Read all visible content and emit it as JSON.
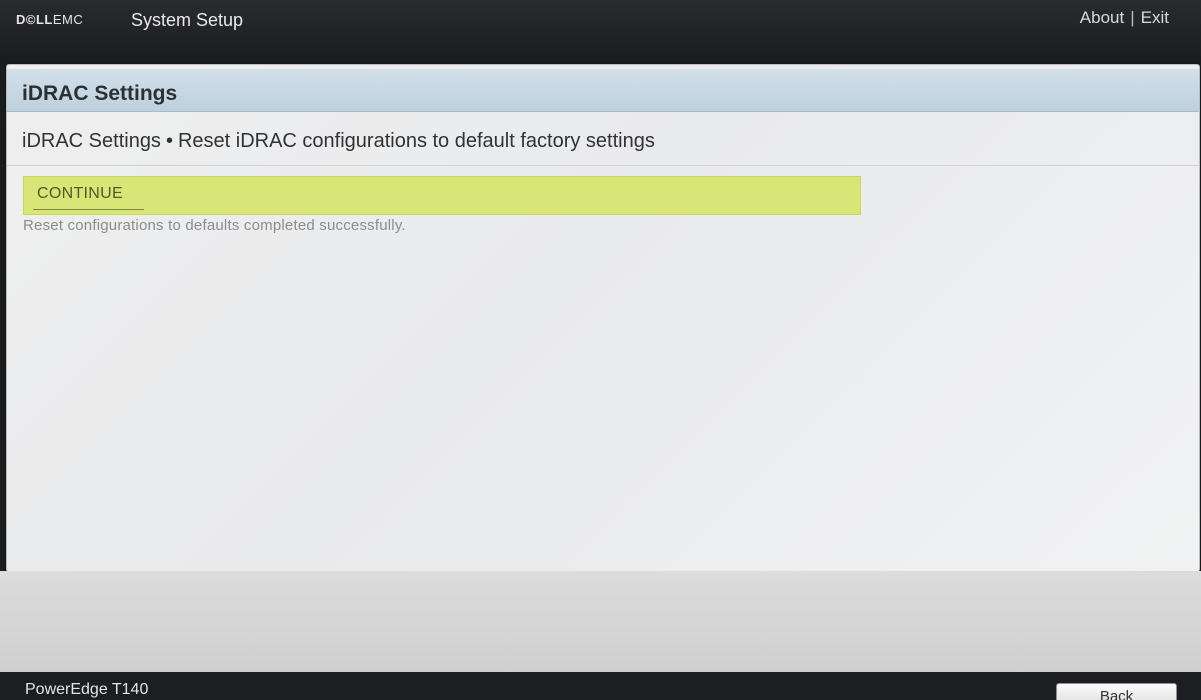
{
  "header": {
    "brand_dell": "D©LL",
    "brand_emc": "EMC",
    "app_title": "System Setup",
    "about_label": "About",
    "separator": "|",
    "exit_label": "Exit"
  },
  "panel": {
    "title": "iDRAC Settings",
    "breadcrumb": {
      "parent": "iDRAC Settings",
      "separator": "•",
      "current": "Reset iDRAC configurations to default factory settings"
    },
    "continue_label": "CONTINUE",
    "status_message": "Reset configurations to defaults completed successfully."
  },
  "footer": {
    "model": "PowerEdge T140",
    "back_label": "Back"
  },
  "colors": {
    "header_bg": "#1c1d20",
    "panel_header_bg": "#c9d8e4",
    "highlight_row": "#d8e677",
    "status_text": "#8a8c8f"
  }
}
